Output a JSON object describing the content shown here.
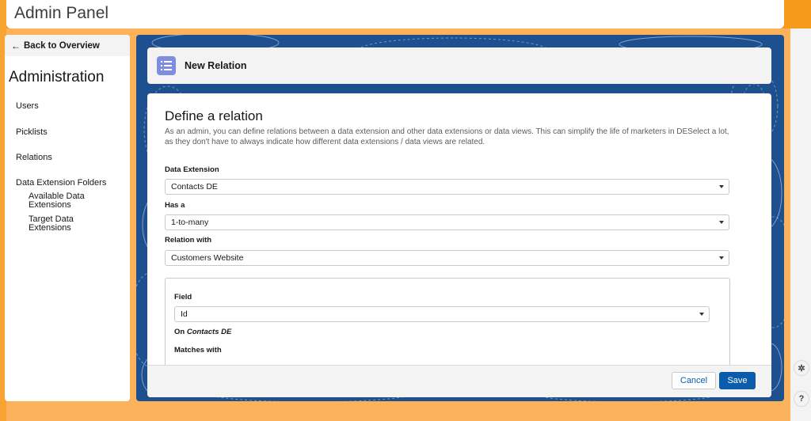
{
  "app": {
    "title": "Admin Panel"
  },
  "sidebar": {
    "back_label": "Back to Overview",
    "title": "Administration",
    "items": [
      {
        "label": "Users"
      },
      {
        "label": "Picklists"
      },
      {
        "label": "Relations"
      },
      {
        "label": "Data Extension Folders"
      }
    ],
    "subitems": [
      {
        "label": "Available Data Extensions"
      },
      {
        "label": "Target Data Extensions"
      }
    ]
  },
  "panel": {
    "header_title": "New Relation",
    "form_title": "Define a relation",
    "description": "As an admin, you can define relations between a data extension and other data extensions or data views. This can simplify the life of marketers in DESelect a lot, as they don't have to always indicate how different data extensions / data views are related.",
    "fields": {
      "data_extension": {
        "label": "Data Extension",
        "value": "Contacts DE"
      },
      "has_a": {
        "label": "Has a",
        "value": "1-to-many"
      },
      "relation_with": {
        "label": "Relation with",
        "value": "Customers Website"
      }
    },
    "mapping": {
      "field_label": "Field",
      "field_value": "Id",
      "on_prefix": "On",
      "on_value": "Contacts DE",
      "matches_label": "Matches with"
    },
    "buttons": {
      "cancel": "Cancel",
      "save": "Save"
    }
  },
  "colors": {
    "accent": "#0b5cab",
    "background": "#fcb25a",
    "panel_bg": "#1e4f8f",
    "icon_bg": "#7f8de1"
  },
  "icons": {
    "back": "arrow-left-icon",
    "relation": "list-icon",
    "utility_1": "settings-icon",
    "utility_2": "help-icon"
  }
}
